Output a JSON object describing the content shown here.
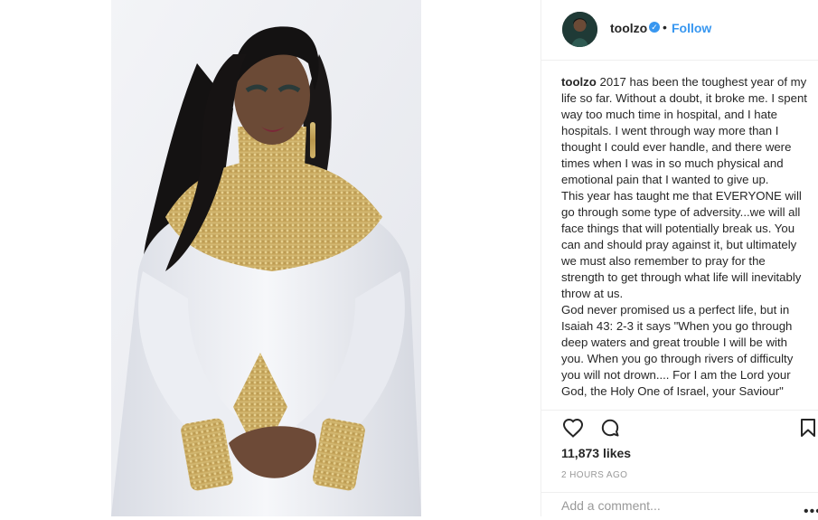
{
  "post": {
    "username": "toolzo",
    "dot": "•",
    "follow_label": "Follow",
    "caption_user": "toolzo",
    "caption_paragraphs": [
      "2017 has been the toughest year of my life so far. Without a doubt, it broke me. I spent way too much time in hospital, and I hate hospitals. I went through way more than I thought I could ever handle, and there were times when I was in so much physical and emotional pain that I wanted to give up.",
      "This year has taught me that EVERYONE will go through some type of adversity...we will all face things that will potentially break us. You can and should pray against it, but ultimately we must also remember to pray for the strength to get through what life will inevitably throw at us.",
      "God never promised us a perfect life, but in Isaiah 43: 2-3 it says \"When you go through deep waters and great trouble I will be with you. When you go through rivers of difficulty you will not drown.... For I am the Lord your God, the Holy One of Israel, your Saviour\""
    ],
    "likes": "11,873 likes",
    "time": "2 HOURS AGO",
    "comment_placeholder": "Add a comment...",
    "more": "•••"
  },
  "icons": {
    "verified": "verified-badge-icon",
    "like": "heart-icon",
    "comment": "comment-bubble-icon",
    "save": "bookmark-icon",
    "more": "more-options-icon"
  },
  "colors": {
    "accent": "#3897f0",
    "text": "#262626",
    "muted": "#999999",
    "border": "#efefef",
    "photo_background": "#eef0f4"
  }
}
